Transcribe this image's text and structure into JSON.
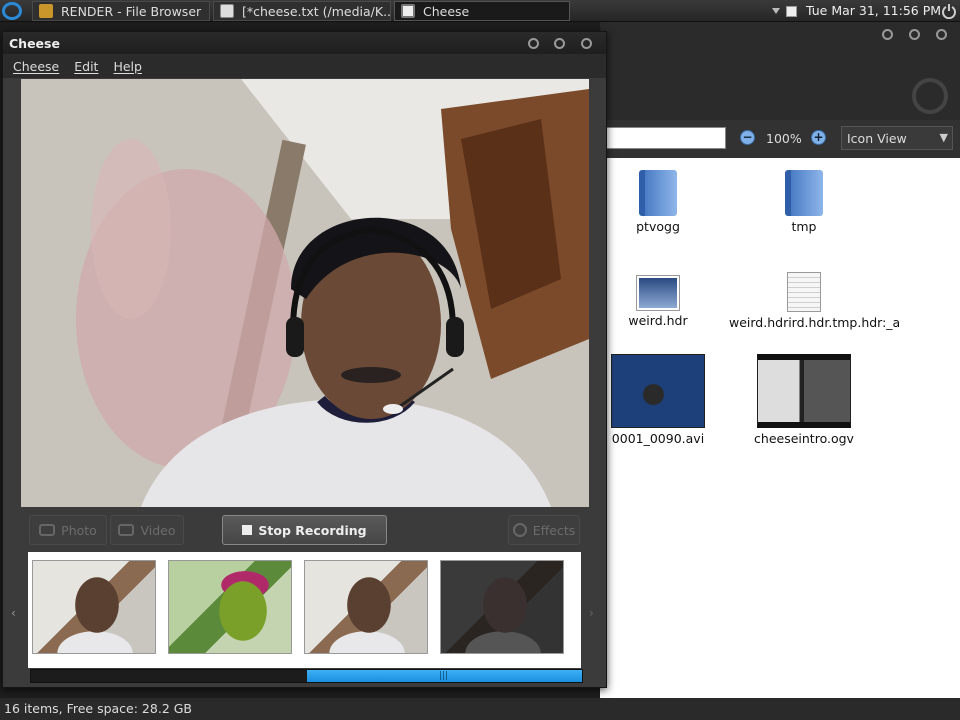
{
  "top_panel": {
    "tasks": [
      {
        "label": "RENDER - File Browser",
        "icon": "folder-icon"
      },
      {
        "label": "[*cheese.txt (/media/K...",
        "icon": "text-editor-icon"
      },
      {
        "label": "Cheese",
        "icon": "cheese-app-icon"
      }
    ],
    "clock": "Tue Mar 31, 11:56 PM"
  },
  "file_browser": {
    "zoom_level": "100%",
    "view_mode": "Icon View",
    "files": [
      {
        "name": "ptvogg",
        "kind": "folder"
      },
      {
        "name": "tmp",
        "kind": "folder"
      },
      {
        "name": "weird.hdr",
        "kind": "image"
      },
      {
        "name": "weird.hdrird.hdr.tmp.hdr:_a",
        "kind": "document"
      },
      {
        "name": "0001_0090.avi",
        "kind": "video"
      },
      {
        "name": "cheeseintro.ogv",
        "kind": "video"
      }
    ],
    "status": "16 items, Free space: 28.2 GB"
  },
  "cheese": {
    "title": "Cheese",
    "menu": [
      "Cheese",
      "Edit",
      "Help"
    ],
    "buttons": {
      "photo": "Photo",
      "video": "Video",
      "stop_recording": "Stop Recording",
      "effects": "Effects"
    },
    "thumbnails": [
      "normal",
      "green-effect",
      "normal",
      "dark"
    ],
    "scroll_position": 0.5
  },
  "colors": {
    "accent": "#2a8ad6",
    "scroll_thumb": "#1a8fe0",
    "window_bg": "#3b3b3b"
  }
}
